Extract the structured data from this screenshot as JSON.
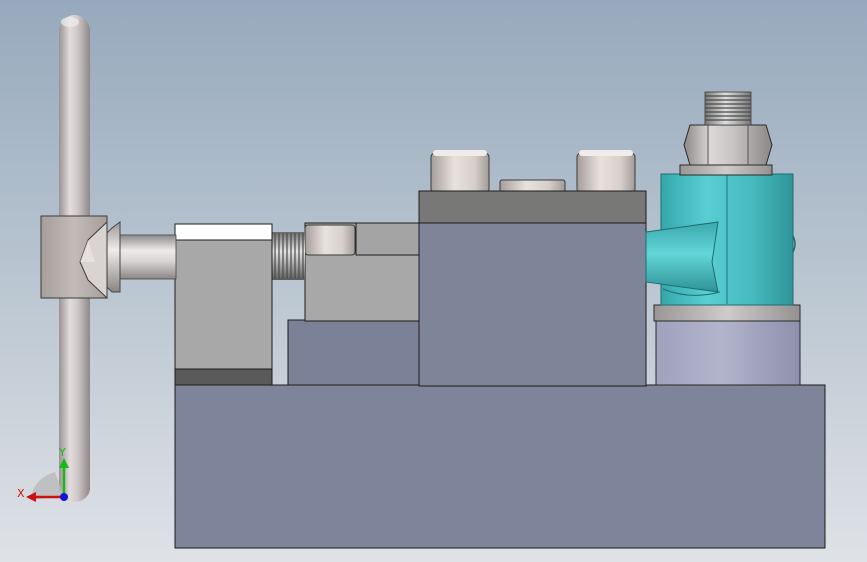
{
  "viewport": {
    "background_top": "#97a9bd",
    "background_bottom": "#dfe2e6"
  },
  "triad": {
    "x_label": "X",
    "y_label": "Y",
    "x_color": "#cc1111",
    "y_color": "#18b818",
    "z_color": "#1515d8"
  },
  "model_colors": {
    "body": "#7e8499",
    "body_dark": "#6f7589",
    "cap_plate": "#787877",
    "jaw_light": "#a8a8a8",
    "jaw_white": "#ffffff",
    "cylinder_teal": "#46bfc3",
    "cylinder_base": "#a5a6c0",
    "handle": "#cbc3c3"
  }
}
